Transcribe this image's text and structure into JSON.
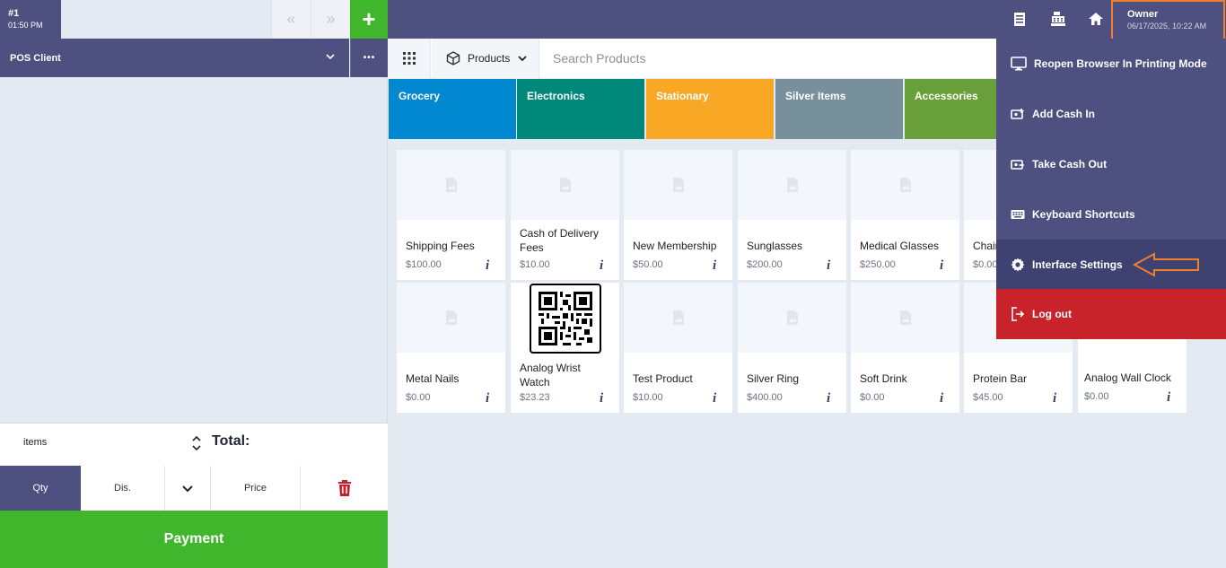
{
  "order": {
    "number": "#1",
    "time": "01:50 PM"
  },
  "left": {
    "client_label": "POS Client",
    "items_label": "items",
    "total_label": "Total:",
    "qty_label": "Qty",
    "dis_label": "Dis.",
    "price_label": "Price",
    "payment_label": "Payment"
  },
  "nav": {
    "prev_glyph": "«",
    "next_glyph": "»",
    "add_glyph": "+",
    "more_glyph": "•••"
  },
  "user": {
    "name": "Owner",
    "datetime": "06/17/2025, 10:22 AM"
  },
  "toolbar": {
    "products_label": "Products",
    "search_placeholder": "Search Products"
  },
  "categories": [
    {
      "label": "Grocery",
      "color": "#0288d1"
    },
    {
      "label": "Electronics",
      "color": "#00897b"
    },
    {
      "label": "Stationary",
      "color": "#f9a825"
    },
    {
      "label": "Silver Items",
      "color": "#78909c"
    },
    {
      "label": "Accessories",
      "color": "#689f38"
    }
  ],
  "products": [
    {
      "name": "Shipping Fees",
      "price": "$100.00"
    },
    {
      "name": "Cash of Delivery Fees",
      "price": "$10.00"
    },
    {
      "name": "New Membership",
      "price": "$50.00"
    },
    {
      "name": "Sunglasses",
      "price": "$200.00"
    },
    {
      "name": "Medical Glasses",
      "price": "$250.00"
    },
    {
      "name": "Chair",
      "price": "$0.00"
    },
    {
      "name": "Metal Nails",
      "price": "$0.00"
    },
    {
      "name": "Analog Wrist Watch",
      "price": "$23.23"
    },
    {
      "name": "Test Product",
      "price": "$10.00"
    },
    {
      "name": "Silver Ring",
      "price": "$400.00"
    },
    {
      "name": "Soft Drink",
      "price": "$0.00"
    },
    {
      "name": "Protein Bar",
      "price": "$45.00"
    },
    {
      "name": "Analog Wall Clock",
      "price": "$0.00"
    }
  ],
  "info_glyph": "i",
  "menu": {
    "items": [
      {
        "label": "Reopen Browser In Printing Mode",
        "icon": "monitor-icon"
      },
      {
        "label": "Add Cash In",
        "icon": "cash-in-icon"
      },
      {
        "label": "Take Cash Out",
        "icon": "cash-out-icon"
      },
      {
        "label": "Keyboard Shortcuts",
        "icon": "keyboard-icon"
      },
      {
        "label": "Interface Settings",
        "icon": "gear-icon"
      },
      {
        "label": "Log out",
        "icon": "logout-icon"
      }
    ]
  },
  "colors": {
    "primary": "#4e5080",
    "success": "#3fb62b",
    "danger": "#c8232b",
    "highlight": "#f07f2a"
  }
}
